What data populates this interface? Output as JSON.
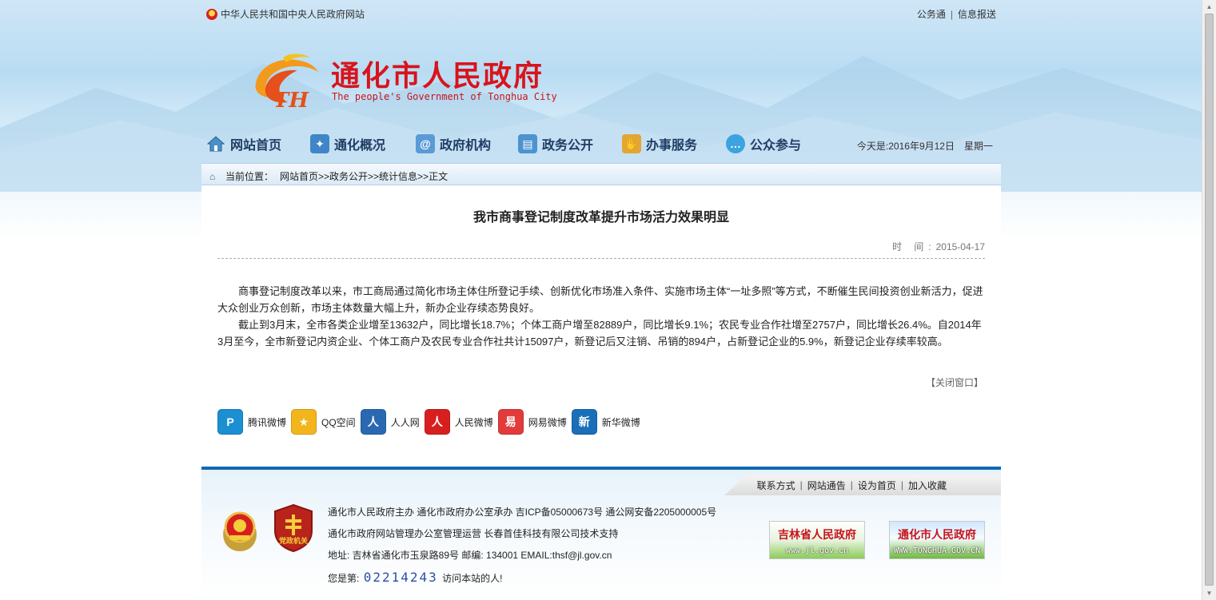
{
  "topbar": {
    "gov_link": "中华人民共和国中央人民政府网站",
    "links": [
      "公务通",
      "信息报送"
    ]
  },
  "header": {
    "title": "通化市人民政府",
    "subtitle": "The people's Government of Tonghua City",
    "logo_text": "TH"
  },
  "nav": {
    "items": [
      {
        "label": "网站首页",
        "icon": "home-icon"
      },
      {
        "label": "通化概况",
        "icon": "overview-icon"
      },
      {
        "label": "政府机构",
        "icon": "organization-icon"
      },
      {
        "label": "政务公开",
        "icon": "document-icon"
      },
      {
        "label": "办事服务",
        "icon": "service-icon"
      },
      {
        "label": "公众参与",
        "icon": "chat-icon"
      }
    ],
    "date_label": "今天是:2016年9月12日",
    "weekday": "星期一"
  },
  "breadcrumb": {
    "label": "当前位置：",
    "path": "网站首页>>政务公开>>统计信息>>正文"
  },
  "article": {
    "title": "我市商事登记制度改革提升市场活力效果明显",
    "time_label": "时 间:",
    "time_value": "2015-04-17",
    "paragraphs": [
      "商事登记制度改革以来，市工商局通过简化市场主体住所登记手续、创新优化市场准入条件、实施市场主体“一址多照”等方式，不断催生民间投资创业新活力，促进大众创业万众创新，市场主体数量大幅上升，新办企业存续态势良好。",
      "截止到3月末，全市各类企业增至13632户，同比增长18.7%；个体工商户增至82889户，同比增长9.1%；农民专业合作社增至2757户，同比增长26.4%。自2014年3月至今，全市新登记内资企业、个体工商户及农民专业合作社共计15097户，新登记后又注销、吊销的894户，占新登记企业的5.9%，新登记企业存续率较高。"
    ],
    "close_label": "【关闭窗口】"
  },
  "share": {
    "items": [
      {
        "label": "腾讯微博",
        "color": "#1b8fd2",
        "glyph": "P"
      },
      {
        "label": "QQ空间",
        "color": "#f2b51c",
        "glyph": "★"
      },
      {
        "label": "人人网",
        "color": "#2b68b2",
        "glyph": "人"
      },
      {
        "label": "人民微博",
        "color": "#d81f1f",
        "glyph": "人"
      },
      {
        "label": "网易微博",
        "color": "#e23b3b",
        "glyph": "易"
      },
      {
        "label": "新华微博",
        "color": "#1a6fb8",
        "glyph": "新"
      }
    ]
  },
  "footer": {
    "links": [
      "联系方式",
      "网站通告",
      "设为首页",
      "加入收藏"
    ],
    "line1": "通化市人民政府主办  通化市政府办公室承办  吉ICP备05000673号  通公网安备2205000005号",
    "line2": "通化市政府网站管理办公室管理运营  长春首佳科技有限公司技术支持",
    "line3": "地址: 吉林省通化市玉泉路89号  邮编: 134001  EMAIL:thsf@jl.gov.cn",
    "visit_prefix": "您是第:",
    "visit_count": "02214243",
    "visit_suffix": "访问本站的人!",
    "badge_text": "党政机关",
    "logo_jl_title": "吉林省人民政府",
    "logo_jl_url": "www.jl.gov.cn",
    "logo_th_title": "通化市人民政府",
    "logo_th_url": "WWW.TONGHUA.GOV.CN"
  }
}
